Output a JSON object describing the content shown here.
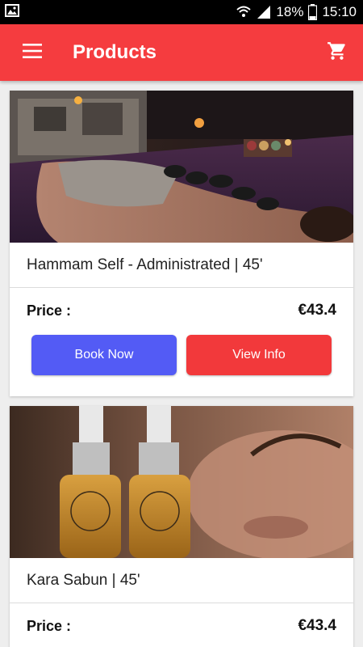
{
  "status_bar": {
    "battery": "18%",
    "time": "15:10",
    "icons": [
      "image-icon",
      "wifi-question-icon",
      "signal-icon",
      "battery-icon"
    ]
  },
  "app_bar": {
    "title": "Products",
    "icons": [
      "menu-icon",
      "cart-icon"
    ],
    "color": "#f53c3f"
  },
  "products": [
    {
      "name": "Hammam Self - Administrated | 45'",
      "price_label": "Price :",
      "price": "€43.4",
      "book_label": "Book Now",
      "info_label": "View Info"
    },
    {
      "name": "Kara Sabun | 45'",
      "price_label": "Price :",
      "price": "€43.4"
    }
  ],
  "colors": {
    "book_button": "#535bf5",
    "info_button": "#f2393b"
  }
}
